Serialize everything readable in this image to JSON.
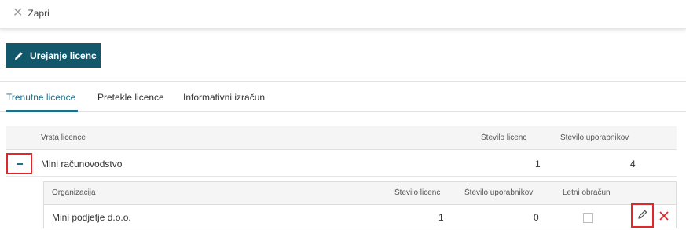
{
  "topbar": {
    "close_label": "Zapri"
  },
  "toolbar": {
    "edit_licenses_label": "Urejanje licenc"
  },
  "tabs": [
    {
      "label": "Trenutne licence",
      "active": true
    },
    {
      "label": "Pretekle licence",
      "active": false
    },
    {
      "label": "Informativni izračun",
      "active": false
    }
  ],
  "licenses_table": {
    "headers": {
      "type": "Vrsta licence",
      "license_count": "Število licenc",
      "user_count": "Število uporabnikov"
    },
    "rows": [
      {
        "type": "Mini računovodstvo",
        "license_count": "1",
        "user_count": "4",
        "expanded": true
      }
    ]
  },
  "org_table": {
    "headers": {
      "organization": "Organizacija",
      "license_count": "Število licenc",
      "user_count": "Število uporabnikov",
      "annual_calc": "Letni obračun"
    },
    "rows": [
      {
        "organization": "Mini podjetje d.o.o.",
        "license_count": "1",
        "user_count": "0",
        "annual_calc": false
      }
    ]
  },
  "icons": {
    "close": "close-icon",
    "edit": "pencil-icon",
    "collapse": "minus-icon",
    "delete": "delete-icon"
  },
  "colors": {
    "primary": "#13576b",
    "active_tab": "#1f6f88",
    "highlight": "#e1262c",
    "delete": "#e1262c"
  }
}
